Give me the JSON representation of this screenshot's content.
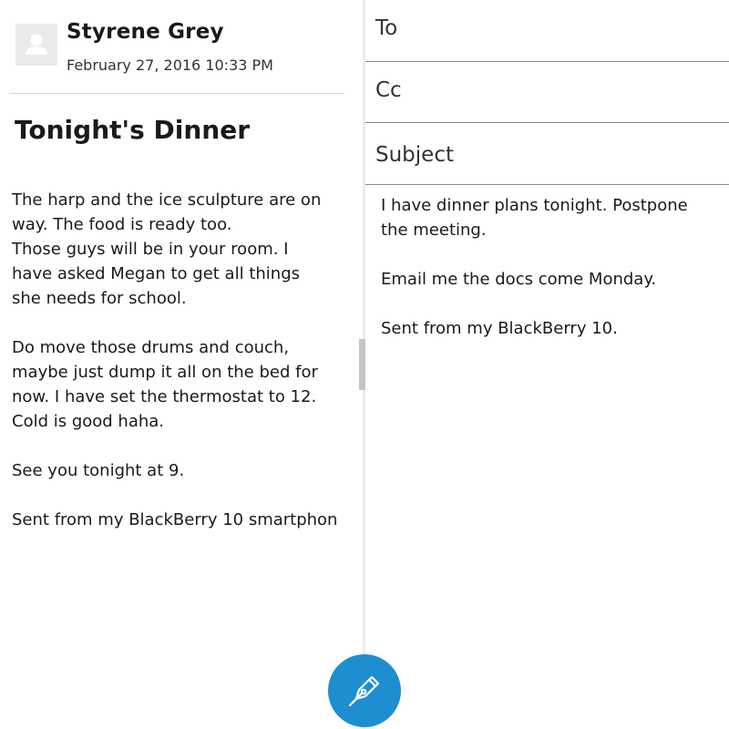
{
  "message": {
    "sender_name": "Styrene Grey",
    "date": "February 27, 2016 10:33 PM",
    "subject": "Tonight's Dinner",
    "paragraphs": [
      "The harp and the ice sculpture are on\nway. The food is ready too.\nThose guys will be in your room. I\nhave asked Megan to get all things\nshe needs for school.",
      "Do move those drums and couch,\nmaybe just dump it all on the bed for\nnow. I have set the thermostat to 12.\nCold is good haha.",
      "See you tonight at 9."
    ],
    "signature": "Sent from my BlackBerry 10 smartphon"
  },
  "compose": {
    "to_label": "To",
    "cc_label": "Cc",
    "subject_label": "Subject",
    "paragraphs": [
      "I have dinner plans tonight. Postpone\nthe meeting.",
      "Email me the docs come Monday.",
      "Sent from my BlackBerry 10."
    ]
  },
  "icons": {
    "avatar": "avatar-placeholder-icon",
    "fab": "fountain-pen-icon"
  },
  "colors": {
    "accent": "#1d8fd0",
    "avatar_bg": "#eaeaea",
    "divider": "#ececec"
  }
}
